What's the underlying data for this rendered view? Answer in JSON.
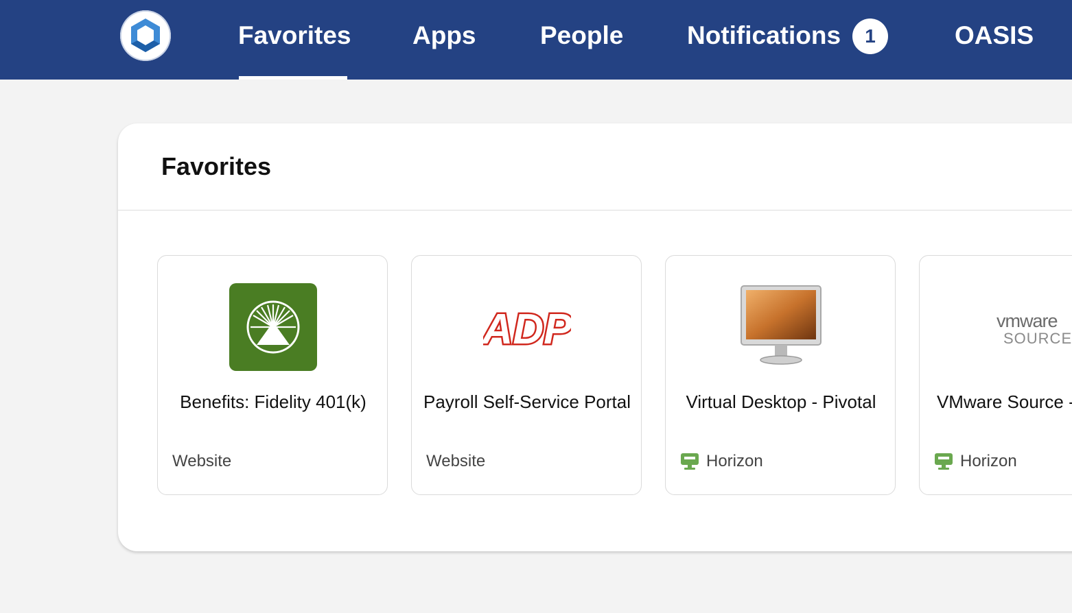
{
  "nav": {
    "items": [
      {
        "label": "Favorites",
        "active": true
      },
      {
        "label": "Apps"
      },
      {
        "label": "People"
      },
      {
        "label": "Notifications",
        "badge": "1"
      },
      {
        "label": "OASIS"
      }
    ]
  },
  "panel": {
    "title": "Favorites"
  },
  "cards": [
    {
      "name": "Benefits: Fidelity 401(k)",
      "type": "Website",
      "icon": "fidelity-logo-icon"
    },
    {
      "name": "Payroll Self-Service Portal",
      "type": "Website",
      "icon": "adp-logo-icon",
      "logo_text": "ADP"
    },
    {
      "name": "Virtual Desktop - Pivotal",
      "type": "Horizon",
      "icon": "desktop-monitor-icon"
    },
    {
      "name": "VMware Source - Pivotal",
      "type": "Horizon",
      "icon": "vmware-source-logo-icon",
      "logo_text_1": "vmware",
      "logo_text_2": "SOURCE"
    }
  ],
  "colors": {
    "topbar": "#244283",
    "fidelity_green": "#4a7d23",
    "adp_red": "#d0271d",
    "horizon_green": "#6aa84f"
  }
}
